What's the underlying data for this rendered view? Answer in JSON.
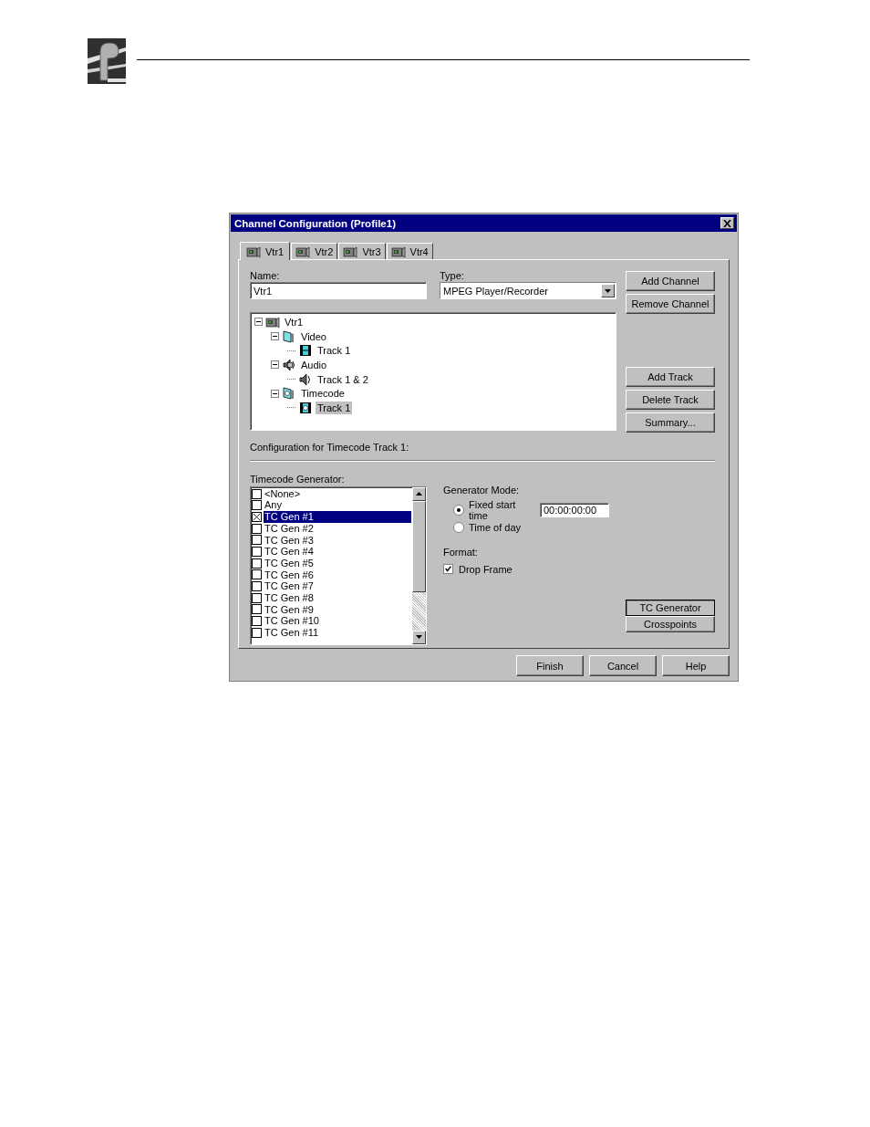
{
  "dialog": {
    "title": "Channel Configuration (Profile1)",
    "tabs": [
      {
        "label": "Vtr1",
        "selected": true
      },
      {
        "label": "Vtr2",
        "selected": false
      },
      {
        "label": "Vtr3",
        "selected": false
      },
      {
        "label": "Vtr4",
        "selected": false
      }
    ],
    "name_label": "Name:",
    "name_value": "Vtr1",
    "type_label": "Type:",
    "type_value": "MPEG Player/Recorder",
    "channel_buttons": [
      "Add Channel",
      "Remove Channel"
    ],
    "tree": [
      {
        "label": "Vtr1",
        "kind": "vtr",
        "expanded": true,
        "selected": false,
        "children": [
          {
            "label": "Video",
            "kind": "video",
            "expanded": true,
            "selected": false,
            "children": [
              {
                "label": "Track 1",
                "kind": "film",
                "selected": false
              }
            ]
          },
          {
            "label": "Audio",
            "kind": "audio",
            "expanded": true,
            "selected": false,
            "children": [
              {
                "label": "Track 1 & 2",
                "kind": "speaker",
                "selected": false
              }
            ]
          },
          {
            "label": "Timecode",
            "kind": "timecode",
            "expanded": true,
            "selected": false,
            "children": [
              {
                "label": "Track 1",
                "kind": "clock",
                "selected": true
              }
            ]
          }
        ]
      }
    ],
    "track_buttons": [
      "Add Track",
      "Delete Track",
      "Summary..."
    ],
    "config_label": "Configuration for Timecode Track 1:",
    "generator_label": "Timecode Generator:",
    "generators": [
      {
        "label": "<None>",
        "checked": false,
        "selected": false
      },
      {
        "label": "Any",
        "checked": false,
        "selected": false
      },
      {
        "label": "TC Gen #1",
        "checked": true,
        "selected": true
      },
      {
        "label": "TC Gen #2",
        "checked": false,
        "selected": false
      },
      {
        "label": "TC Gen #3",
        "checked": false,
        "selected": false
      },
      {
        "label": "TC Gen #4",
        "checked": false,
        "selected": false
      },
      {
        "label": "TC Gen #5",
        "checked": false,
        "selected": false
      },
      {
        "label": "TC Gen #6",
        "checked": false,
        "selected": false
      },
      {
        "label": "TC Gen #7",
        "checked": false,
        "selected": false
      },
      {
        "label": "TC Gen #8",
        "checked": false,
        "selected": false
      },
      {
        "label": "TC Gen #9",
        "checked": false,
        "selected": false
      },
      {
        "label": "TC Gen #10",
        "checked": false,
        "selected": false
      },
      {
        "label": "TC Gen #11",
        "checked": false,
        "selected": false
      }
    ],
    "mode_label": "Generator Mode:",
    "modes": [
      {
        "label": "Fixed start time",
        "selected": true,
        "value": "00:00:00:00"
      },
      {
        "label": "Time of day",
        "selected": false
      }
    ],
    "format_label": "Format:",
    "drop_frame": {
      "label": "Drop Frame",
      "checked": true
    },
    "view_buttons": [
      {
        "label": "TC Generator",
        "selected": true
      },
      {
        "label": "Crosspoints",
        "selected": false
      }
    ],
    "footer_buttons": [
      "Finish",
      "Cancel",
      "Help"
    ]
  }
}
